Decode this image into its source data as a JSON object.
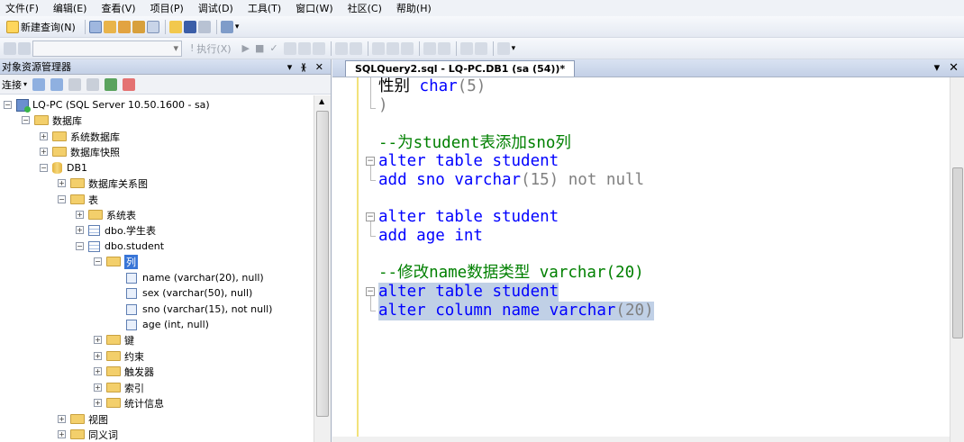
{
  "menu": [
    "文件(F)",
    "编辑(E)",
    "查看(V)",
    "项目(P)",
    "调试(D)",
    "工具(T)",
    "窗口(W)",
    "社区(C)",
    "帮助(H)"
  ],
  "toolbar": {
    "new_query": "新建查询(N)",
    "execute": "执行(X)"
  },
  "object_explorer": {
    "title": "对象资源管理器",
    "pin_label": "▾ ᚕ ✕",
    "connect": "连接"
  },
  "tree": {
    "server": "LQ-PC (SQL Server 10.50.1600 - sa)",
    "databases": "数据库",
    "system_dbs": "系统数据库",
    "snapshots": "数据库快照",
    "db1": "DB1",
    "diagrams": "数据库关系图",
    "tables": "表",
    "system_tables": "系统表",
    "table1": "dbo.学生表",
    "table2": "dbo.student",
    "columns": "列",
    "col1": "name (varchar(20), null)",
    "col2": "sex (varchar(50), null)",
    "col3": "sno (varchar(15), not null)",
    "col4": "age (int, null)",
    "keys": "键",
    "constraints": "约束",
    "triggers": "触发器",
    "indexes": "索引",
    "stats": "统计信息",
    "views": "视图",
    "synonyms": "同义词"
  },
  "editor": {
    "tab_title": "SQLQuery2.sql - LQ-PC.DB1 (sa (54))*",
    "code": {
      "l1_a": "性别 ",
      "l1_b": "char",
      "l1_c": "(5)",
      "l2": ")",
      "l3": "--为student表添加sno列",
      "l4_kw": "alter table ",
      "l4_id": "student",
      "l5_kw": "add ",
      "l5_id": "sno ",
      "l5_type": "varchar",
      "l5_p": "(15) ",
      "l5_rest": "not null",
      "l6_kw": "alter table ",
      "l6_id": "student",
      "l7_kw": "add ",
      "l7_id": "age ",
      "l7_type": "int",
      "l8": "--修改name数据类型 varchar(20)",
      "l9_kw": "alter table ",
      "l9_id": "student",
      "l10_kw": "alter column ",
      "l10_id": "name ",
      "l10_type": "varchar",
      "l10_p": "(20)"
    }
  }
}
